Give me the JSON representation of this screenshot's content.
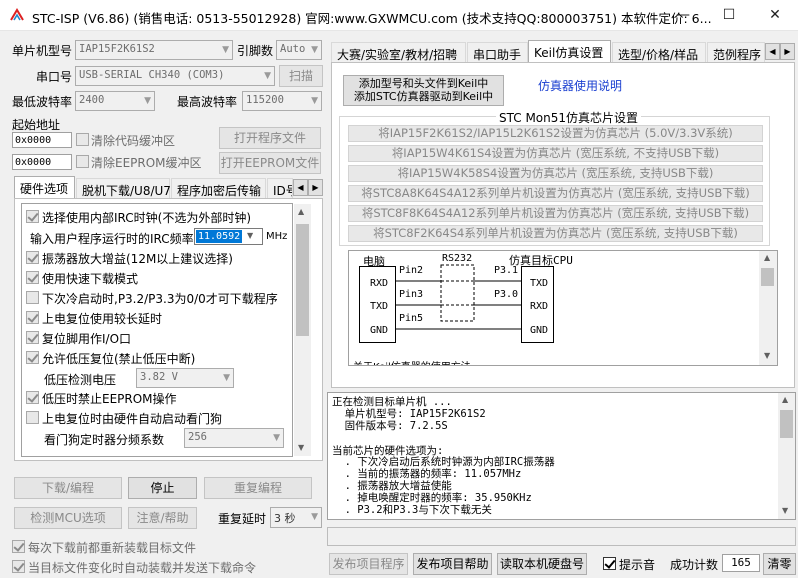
{
  "title": "STC-ISP (V6.86) (销售电话: 0513-55012928) 官网:www.GXWMCU.com  (技术支持QQ:800003751) 本软件定价: 6...",
  "window_controls": {
    "minimize": "—",
    "maximize": "☐",
    "close": "✕"
  },
  "left": {
    "mcu_label": "单片机型号",
    "mcu_value": "IAP15F2K61S2",
    "pin_label": "引脚数",
    "pin_value": "Auto",
    "port_label": "串口号",
    "port_value": "USB-SERIAL CH340 (COM3)",
    "scan_btn": "扫描",
    "min_baud_label": "最低波特率",
    "min_baud_value": "2400",
    "max_baud_label": "最高波特率",
    "max_baud_value": "115200",
    "start_addr_label": "起始地址",
    "addr1": "0x0000",
    "clear_code_label": "清除代码缓冲区",
    "open_prog_btn": "打开程序文件",
    "addr2": "0x0000",
    "clear_eeprom_label": "清除EEPROM缓冲区",
    "open_eeprom_btn": "打开EEPROM文件",
    "tabs": [
      "硬件选项",
      "脱机下载/U8/U7",
      "程序加密后传输",
      "ID号"
    ],
    "options": [
      {
        "label": "选择使用内部IRC时钟(不选为外部时钟)",
        "checked": true
      },
      {
        "label": "振荡器放大增益(12M以上建议选择)",
        "checked": true
      },
      {
        "label": "使用快速下载模式",
        "checked": true
      },
      {
        "label": "下次冷启动时,P3.2/P3.3为0/0才可下载程序",
        "checked": false
      },
      {
        "label": "上电复位使用较长延时",
        "checked": true
      },
      {
        "label": "复位脚用作I/O口",
        "checked": true
      },
      {
        "label": "允许低压复位(禁止低压中断)",
        "checked": true
      },
      {
        "label": "低压时禁止EEPROM操作",
        "checked": true
      },
      {
        "label": "上电复位时由硬件自动启动看门狗",
        "checked": false
      }
    ],
    "irc_label": "输入用户程序运行时的IRC频率",
    "irc_value": "11.0592",
    "irc_unit": "MHz",
    "lv_label": "低压检测电压",
    "lv_value": "3.82 V",
    "wdt_label": "看门狗定时器分频系数",
    "wdt_value": "256",
    "download_btn": "下载/编程",
    "stop_btn": "停止",
    "reprog_btn": "重复编程",
    "check_mcu_btn": "检测MCU选项",
    "help_btn": "注意/帮助",
    "delay_label": "重复延时",
    "delay_value": "3 秒",
    "reload_label": "每次下载前都重新装载目标文件",
    "auto_label": "当目标文件变化时自动装载并发送下载命令"
  },
  "right": {
    "tabs": [
      "大赛/实验室/教材/招聘",
      "串口助手",
      "Keil仿真设置",
      "选型/价格/样品",
      "范例程序"
    ],
    "add_btn_line1": "添加型号和头文件到Keil中",
    "add_btn_line2": "添加STC仿真器驱动到Keil中",
    "emu_link": "仿真器使用说明",
    "group_title": "STC Mon51仿真芯片设置",
    "set_buttons": [
      "将IAP15F2K61S2/IAP15L2K61S2设置为仿真芯片 (5.0V/3.3V系统)",
      "将IAP15W4K61S4设置为仿真芯片 (宽压系统, 不支持USB下载)",
      "将IAP15W4K58S4设置为仿真芯片 (宽压系统, 支持USB下载)",
      "将STC8A8K64S4A12系列单片机设置为仿真芯片 (宽压系统, 支持USB下载)",
      "将STC8F8K64S4A12系列单片机设置为仿真芯片 (宽压系统, 支持USB下载)",
      "将STC8F2K64S4系列单片机设置为仿真芯片 (宽压系统, 支持USB下载)"
    ],
    "diagram": {
      "pc": "电脑",
      "rs232": "RS232",
      "target": "仿真目标CPU",
      "rxd": "RXD",
      "txd": "TXD",
      "gnd": "GND",
      "pin2": "Pin2",
      "pin3": "Pin3",
      "pin5": "Pin5",
      "p31": "P3.1",
      "p30": "P3.0",
      "footer": "关于Keil仿真器的使用方法"
    },
    "log": [
      "正在检测目标单片机 ...",
      "  单片机型号: IAP15F2K61S2",
      "  固件版本号: 7.2.5S",
      "",
      "当前芯片的硬件选项为:",
      "  . 下次冷启动后系统时钟源为内部IRC振荡器",
      "  . 当前的振荡器的频率: 11.057MHz",
      "  . 振荡器放大增益使能",
      "  . 掉电唤醒定时器的频率: 35.950KHz",
      "  . P3.2和P3.3与下次下载无关"
    ],
    "publish_btn": "发布项目程序",
    "publish_help_btn": "发布项目帮助",
    "read_disk_btn": "读取本机硬盘号",
    "prompt_label": "提示音",
    "success_label": "成功计数",
    "success_value": "165",
    "clear_btn": "清零"
  }
}
